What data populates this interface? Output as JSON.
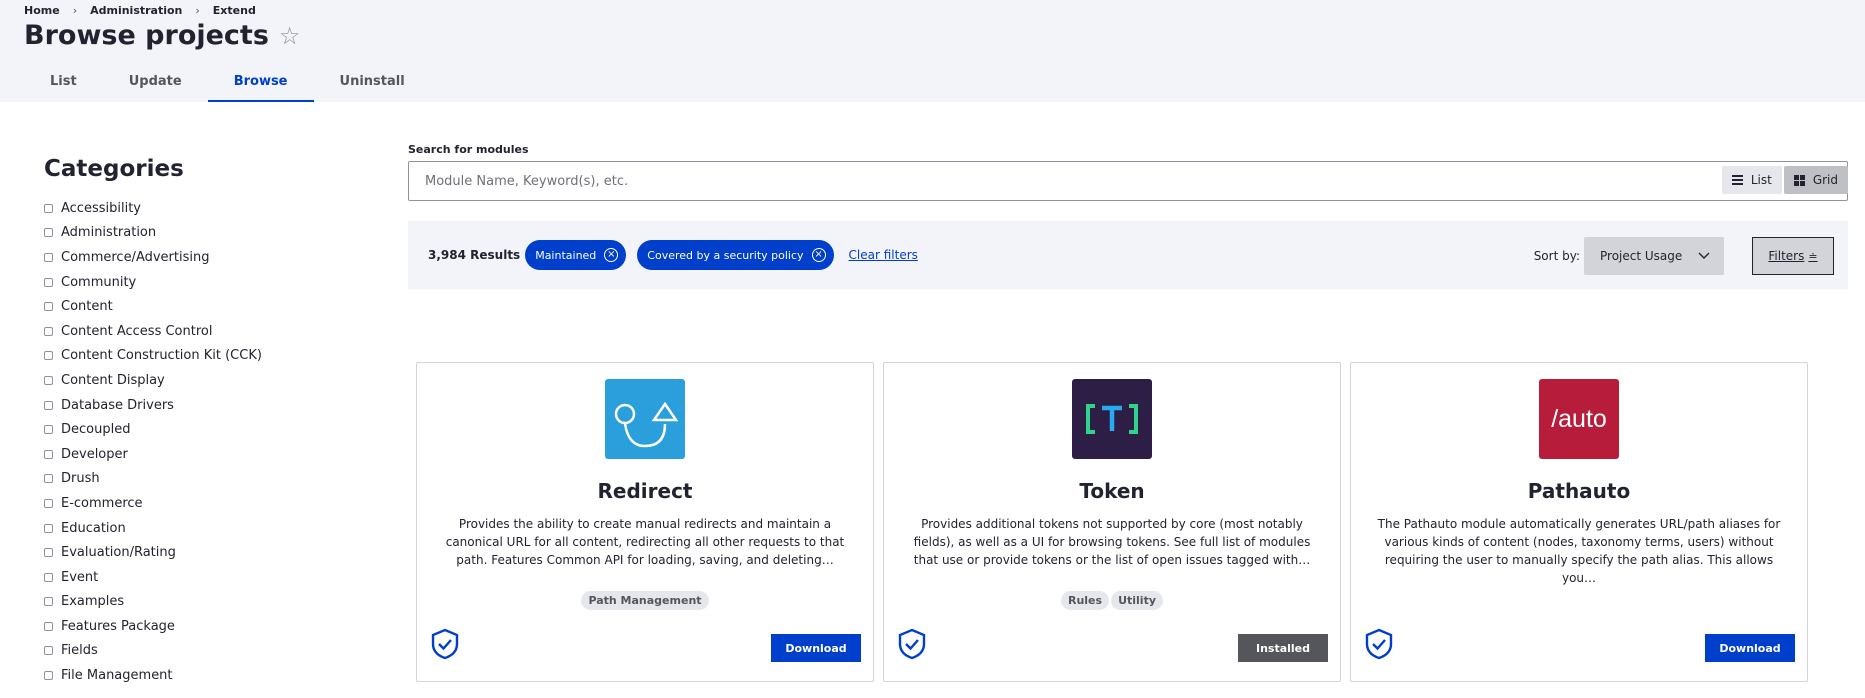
{
  "breadcrumb": [
    "Home",
    "Administration",
    "Extend"
  ],
  "page_title": "Browse projects",
  "tabs": [
    {
      "label": "List"
    },
    {
      "label": "Update"
    },
    {
      "label": "Browse",
      "active": true
    },
    {
      "label": "Uninstall"
    }
  ],
  "sidebar": {
    "heading": "Categories",
    "categories": [
      "Accessibility",
      "Administration",
      "Commerce/Advertising",
      "Community",
      "Content",
      "Content Access Control",
      "Content Construction Kit (CCK)",
      "Content Display",
      "Database Drivers",
      "Decoupled",
      "Developer",
      "Drush",
      "E-commerce",
      "Education",
      "Evaluation/Rating",
      "Event",
      "Examples",
      "Features Package",
      "Fields",
      "File Management"
    ]
  },
  "search": {
    "label": "Search for modules",
    "placeholder": "Module Name, Keyword(s), etc.",
    "value": ""
  },
  "filters": {
    "results": "3,984 Results",
    "chips": [
      "Maintained",
      "Covered by a security policy"
    ],
    "clear_label": "Clear filters",
    "sort_label": "Sort by:",
    "sort_value": "Project Usage",
    "filters_button": "Filters"
  },
  "view_toggle": {
    "list": "List",
    "grid": "Grid",
    "active": "grid"
  },
  "projects": [
    {
      "title": "Redirect",
      "description": "Provides the ability to create manual redirects and maintain a canonical URL for all content, redirecting all other requests to that path. Features Common API for loading, saving, and deleting…",
      "tags": [
        "Path Management"
      ],
      "action": "Download",
      "logo_color": "#2a9fdb"
    },
    {
      "title": "Token",
      "description": "Provides additional tokens not supported by core (most notably fields), as well as a UI for browsing tokens. See full list of modules that use or provide tokens or the list of open issues tagged with…",
      "tags": [
        "Rules",
        "Utility"
      ],
      "action": "Installed",
      "logo_color": "#2c1e44"
    },
    {
      "title": "Pathauto",
      "description": "The Pathauto module automatically generates URL/path aliases for various kinds of content (nodes, taxonomy terms, users) without requiring the user to manually specify the path alias. This allows you…",
      "tags": [],
      "action": "Download",
      "logo_color": "#b71c3a"
    }
  ],
  "colors": {
    "accent": "#003ecc",
    "header_bg": "#f3f4f9",
    "installed": "#55565b"
  }
}
